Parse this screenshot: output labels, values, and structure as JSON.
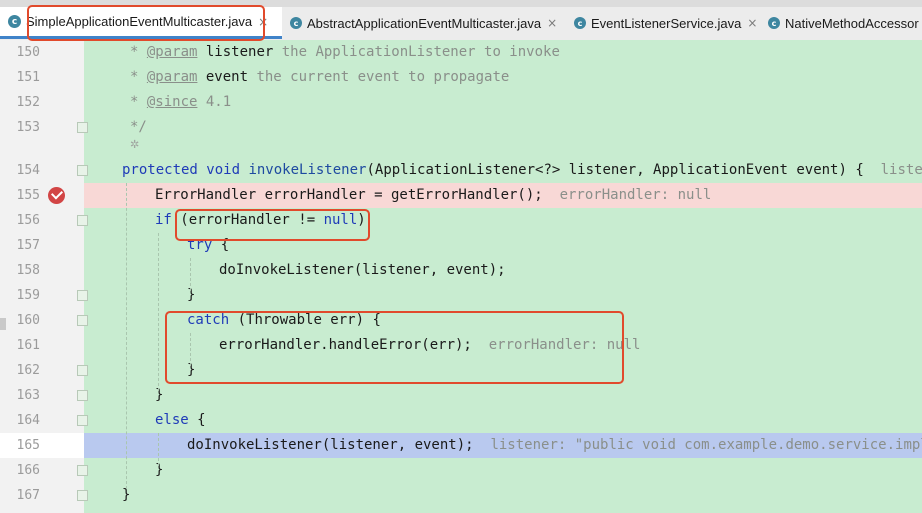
{
  "tabs": [
    {
      "label": "SimpleApplicationEventMulticaster.java",
      "active": true,
      "close": "×"
    },
    {
      "label": "AbstractApplicationEventMulticaster.java",
      "active": false,
      "close": "×"
    },
    {
      "label": "EventListenerService.java",
      "active": false,
      "close": "×"
    },
    {
      "label": "NativeMethodAccessor",
      "active": false,
      "close": ""
    }
  ],
  "tab_icon_letter": "c",
  "lines": [
    {
      "num": "150",
      "parts": [
        "* ",
        "@param",
        " listener ",
        "the ApplicationListener to invoke"
      ]
    },
    {
      "num": "151",
      "parts": [
        "* ",
        "@param",
        " event ",
        "the current event to propagate"
      ]
    },
    {
      "num": "152",
      "parts": [
        "* ",
        "@since",
        " 4.1"
      ]
    },
    {
      "num": "153",
      "parts": [
        "*/"
      ]
    },
    {
      "num": "154",
      "parts": [
        "protected",
        " ",
        "void",
        " ",
        "invokeListener",
        "(ApplicationListener<?> listener, ApplicationEvent event) {  ",
        "listener: "
      ]
    },
    {
      "num": "155",
      "parts": [
        "ErrorHandler errorHandler = getErrorHandler();  ",
        "errorHandler: null"
      ]
    },
    {
      "num": "156",
      "parts": [
        "if",
        " (errorHandler != ",
        "null",
        ")"
      ]
    },
    {
      "num": "157",
      "parts": [
        "try",
        " {"
      ]
    },
    {
      "num": "158",
      "parts": [
        "doInvokeListener(listener, event);"
      ]
    },
    {
      "num": "159",
      "parts": [
        "}"
      ]
    },
    {
      "num": "160",
      "parts": [
        "catch",
        " (Throwable err) {"
      ]
    },
    {
      "num": "161",
      "parts": [
        "errorHandler.handleError(err);  ",
        "errorHandler: null"
      ]
    },
    {
      "num": "162",
      "parts": [
        "}"
      ]
    },
    {
      "num": "163",
      "parts": [
        "}"
      ]
    },
    {
      "num": "164",
      "parts": [
        "else",
        " {"
      ]
    },
    {
      "num": "165",
      "parts": [
        "doInvokeListener(listener, event);  ",
        "listener: \"public void com.example.demo.service.impl.Eve"
      ]
    },
    {
      "num": "166",
      "parts": [
        "}"
      ]
    },
    {
      "num": "167",
      "parts": [
        "}"
      ]
    }
  ],
  "colors": {
    "editor_bg": "#c8ecd0",
    "error_line": "#f8d8d6",
    "exec_line": "#b9c9ef",
    "keyword": "#1f3bb8",
    "annotation_box": "#e14a2c"
  },
  "icons": {
    "breakpoint": "breakpoint-check-icon",
    "debug_hint": "debug-gear-icon",
    "class": "class-icon"
  }
}
